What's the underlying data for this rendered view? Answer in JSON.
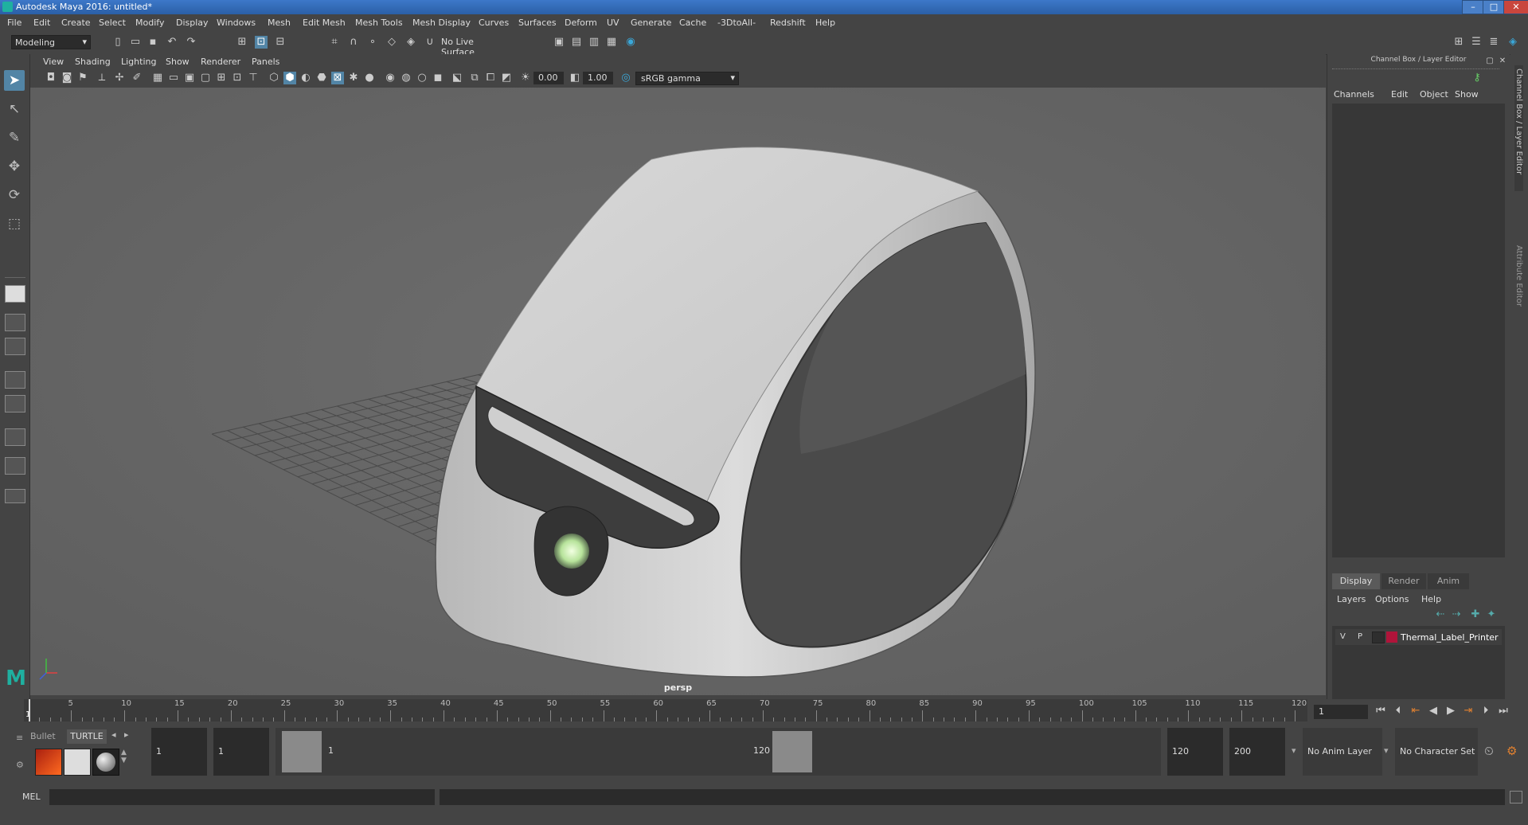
{
  "app": {
    "title": "Autodesk Maya 2016: untitled*"
  },
  "menubar": [
    "File",
    "Edit",
    "Create",
    "Select",
    "Modify",
    "Display",
    "Windows",
    "Mesh",
    "Edit Mesh",
    "Mesh Tools",
    "Mesh Display",
    "Curves",
    "Surfaces",
    "Deform",
    "UV",
    "Generate",
    "Cache",
    "-3DtoAll-",
    "Redshift",
    "Help"
  ],
  "statusline": {
    "mode": "Modeling",
    "live_surface": "No Live Surface"
  },
  "panel": {
    "menus": [
      "View",
      "Shading",
      "Lighting",
      "Show",
      "Renderer",
      "Panels"
    ],
    "exposure": "0.00",
    "gamma": "1.00",
    "color_space": "sRGB gamma",
    "camera_label": "persp"
  },
  "channel_box": {
    "title": "Channel Box / Layer Editor",
    "menus": [
      "Channels",
      "Edit",
      "Object",
      "Show"
    ]
  },
  "layer_editor": {
    "tabs": [
      "Display",
      "Render",
      "Anim"
    ],
    "menus": [
      "Layers",
      "Options",
      "Help"
    ],
    "layers": [
      {
        "v": "V",
        "p": "P",
        "name": "Thermal_Label_Printer",
        "color": "#b0143a"
      }
    ]
  },
  "side_tabs": [
    "Channel Box / Layer Editor",
    "Attribute Editor"
  ],
  "timeline": {
    "ticks": [
      "1",
      "5",
      "10",
      "15",
      "20",
      "25",
      "30",
      "35",
      "40",
      "45",
      "50",
      "55",
      "60",
      "65",
      "70",
      "75",
      "80",
      "85",
      "90",
      "95",
      "100",
      "105",
      "110",
      "115",
      "120"
    ],
    "current_frame": "1"
  },
  "range": {
    "shelf_tabs": [
      "Bullet",
      "TURTLE"
    ],
    "start_time": "1",
    "playback_start": "1",
    "slider_start": "1",
    "slider_end": "120",
    "playback_end": "120",
    "end_time": "200",
    "anim_layer": "No Anim Layer",
    "character_set": "No Character Set"
  },
  "command": {
    "label": "MEL"
  },
  "colors": {
    "selected_tool": "#5285a6",
    "layer_color": "#b0143a",
    "title_bar": "#2b5fa6"
  }
}
